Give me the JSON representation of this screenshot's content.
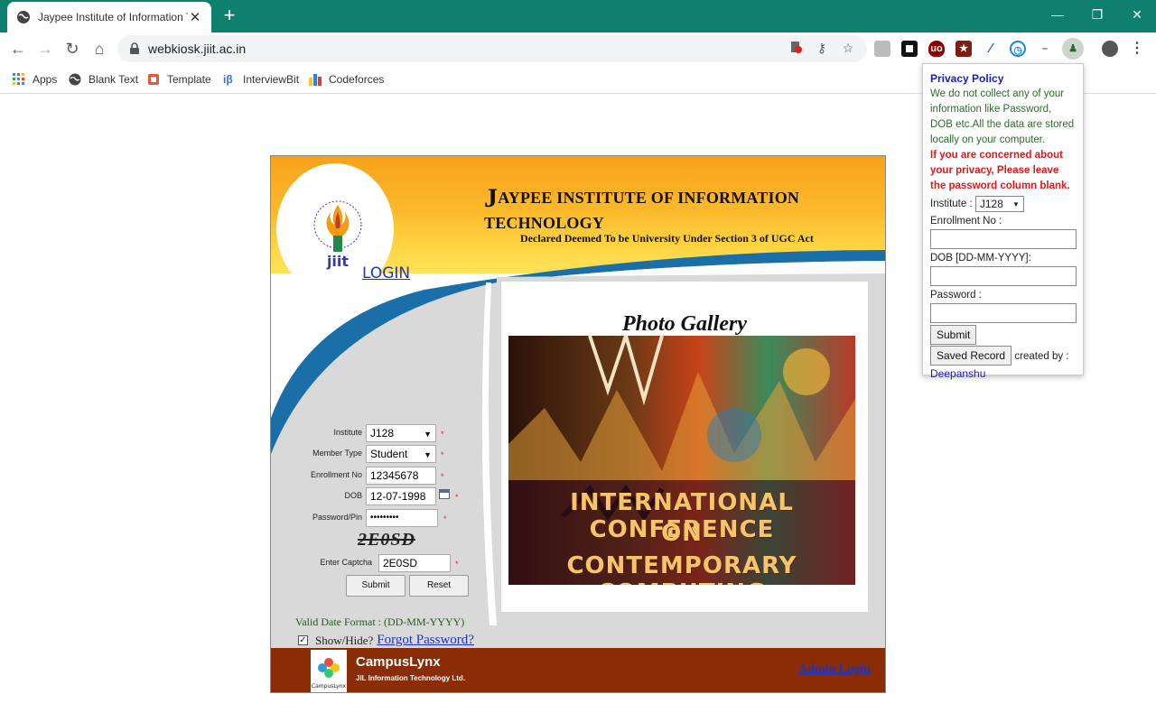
{
  "browser": {
    "tab_title": "Jaypee Institute of Information Te",
    "url": "webkiosk.jiit.ac.in",
    "window_controls": [
      "minimize",
      "restore",
      "close"
    ],
    "bookmarks": [
      {
        "label": "Apps",
        "icon": "apps-grid-icon"
      },
      {
        "label": "Blank Text",
        "icon": "globe-icon"
      },
      {
        "label": "Template",
        "icon": "template-icon"
      },
      {
        "label": "InterviewBit",
        "icon": "interviewbit-icon"
      },
      {
        "label": "Codeforces",
        "icon": "codeforces-icon"
      }
    ]
  },
  "header": {
    "title_initial": "J",
    "title_rest": "AYPEE INSTITUTE OF INFORMATION TECHNOLOGY",
    "subtitle": "Declared Deemed To be University Under Section 3 of UGC Act",
    "logo_text": "jiit"
  },
  "gallery": {
    "title": "Photo Gallery",
    "photo_line1": "INTERNATIONAL CONFERENCE",
    "photo_line2": "ON",
    "photo_line3": "CONTEMPORARY COMPUTING"
  },
  "login": {
    "title": "LOGIN",
    "institute_label": "Institute",
    "institute_value": "J128",
    "member_type_label": "Member Type",
    "member_type_value": "Student",
    "enrollment_label": "Enrollment No",
    "enrollment_value": "12345678",
    "dob_label": "DOB",
    "dob_value": "12-07-1998",
    "password_label": "Password/Pin",
    "password_value": "•••••••••",
    "captcha_image_text": "2E0SD",
    "captcha_label": "Enter Captcha",
    "captcha_value": "2E0SD",
    "submit_label": "Submit",
    "reset_label": "Reset",
    "required_mark": "*",
    "date_format_note": "Valid Date Format : (DD-MM-YYYY)",
    "show_hide_label": "Show/Hide?",
    "forgot_password": "Forgot Password?"
  },
  "footer": {
    "brand": "CampusLynx",
    "company": "JIL Information Technology Ltd.",
    "logo_caption": "CampusLynx",
    "admin_login": "Admin Login"
  },
  "popup": {
    "title": "Privacy Policy",
    "body": "We do not collect any of your information like Password, DOB etc.All the data are stored locally on your computer.",
    "warning": "If you are concerned about your privacy, Please leave the password column blank.",
    "institute_label": "Institute :",
    "institute_value": "J128",
    "enrollment_label": "Enrollment No :",
    "dob_label": "DOB [DD-MM-YYYY]:",
    "password_label": "Password :",
    "submit_label": "Submit",
    "saved_record_label": "Saved Record",
    "created_by": "created by :",
    "author": "Deepanshu"
  },
  "colors": {
    "tabbar": "#0f7f6e",
    "header_orange": "#f7a21b",
    "footer_brown": "#8a2c05",
    "link_blue": "#1a34c8"
  }
}
